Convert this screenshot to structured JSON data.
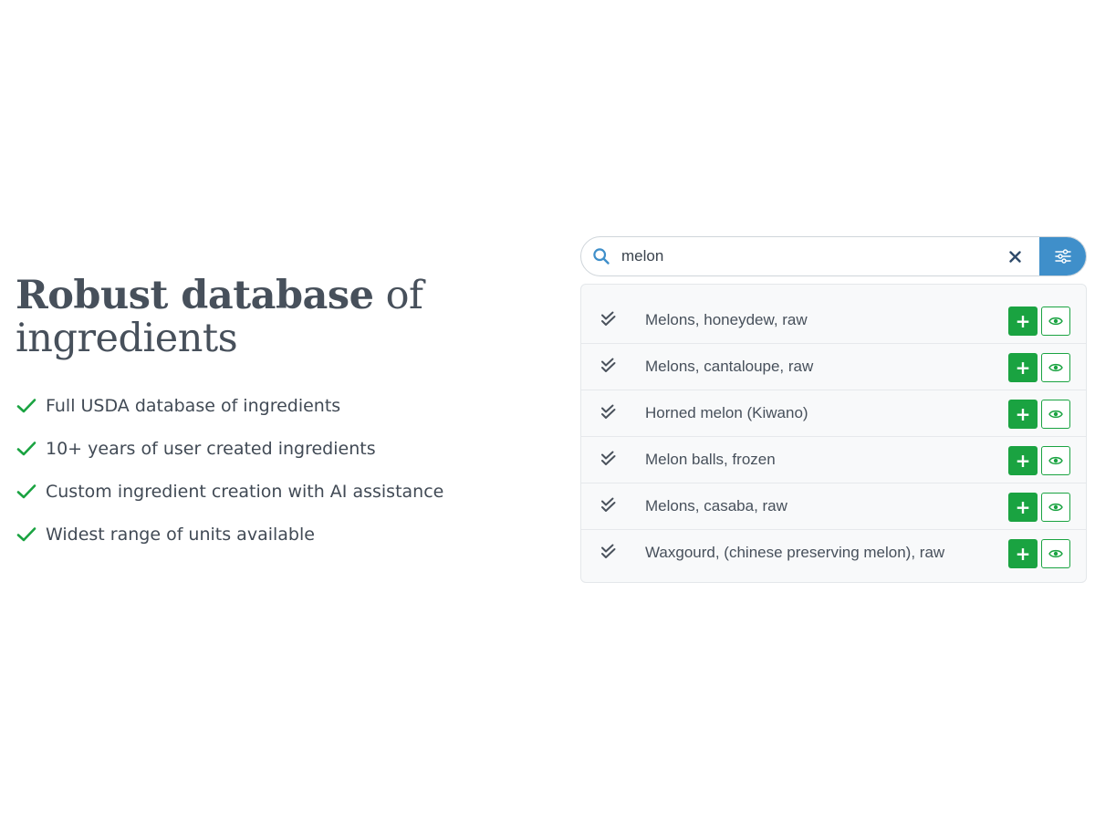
{
  "headline": {
    "bold": "Robust database",
    "rest": " of ingredients"
  },
  "features": [
    {
      "text": "Full USDA database of ingredients",
      "icon": "check-icon"
    },
    {
      "text": "10+ years of user created ingredients",
      "icon": "check-icon"
    },
    {
      "text": "Custom ingredient creation with AI assistance",
      "icon": "check-icon"
    },
    {
      "text": "Widest range of units available",
      "icon": "check-icon"
    }
  ],
  "search": {
    "value": "melon",
    "icon": "search-icon",
    "clear_icon": "close-icon",
    "filter_icon": "sliders-icon"
  },
  "results": [
    {
      "label": "Melons, honeydew, raw"
    },
    {
      "label": "Melons, cantaloupe, raw"
    },
    {
      "label": "Horned melon (Kiwano)"
    },
    {
      "label": "Melon balls, frozen"
    },
    {
      "label": "Melons, casaba, raw"
    },
    {
      "label": "Waxgourd, (chinese preserving melon), raw"
    }
  ],
  "result_actions": {
    "add_label": "+",
    "add_icon": "plus-icon",
    "view_icon": "eye-icon",
    "status_icon": "double-check-icon"
  },
  "colors": {
    "accent_green": "#1aa341",
    "filter_blue": "#3f8fca",
    "search_icon_blue": "#3f8fca",
    "text_dark": "#47505b"
  }
}
